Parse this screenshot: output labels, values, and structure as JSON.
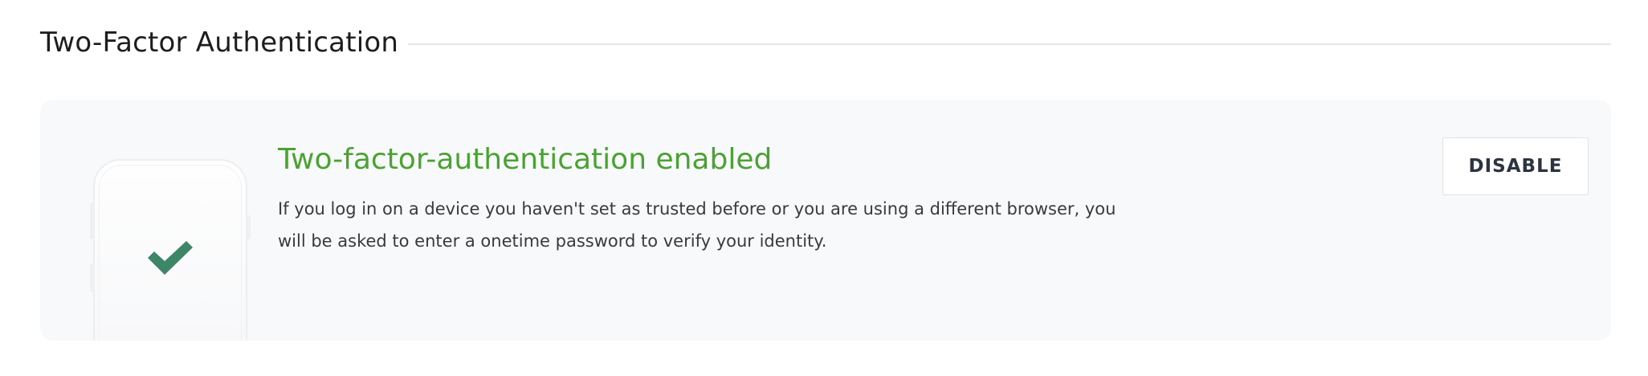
{
  "section": {
    "title": "Two-Factor Authentication"
  },
  "status": {
    "title": "Two-factor-authentication enabled",
    "description": "If you log in on a device you haven't set as trusted before or you are using a different browser, you will be asked to enter a onetime password to verify your identity."
  },
  "actions": {
    "disable_label": "DISABLE"
  },
  "colors": {
    "status_green": "#4aa331",
    "check_green": "#3f8668",
    "card_background": "#f8f9fb"
  },
  "icons": {
    "phone": "phone-icon",
    "check": "check-icon"
  }
}
